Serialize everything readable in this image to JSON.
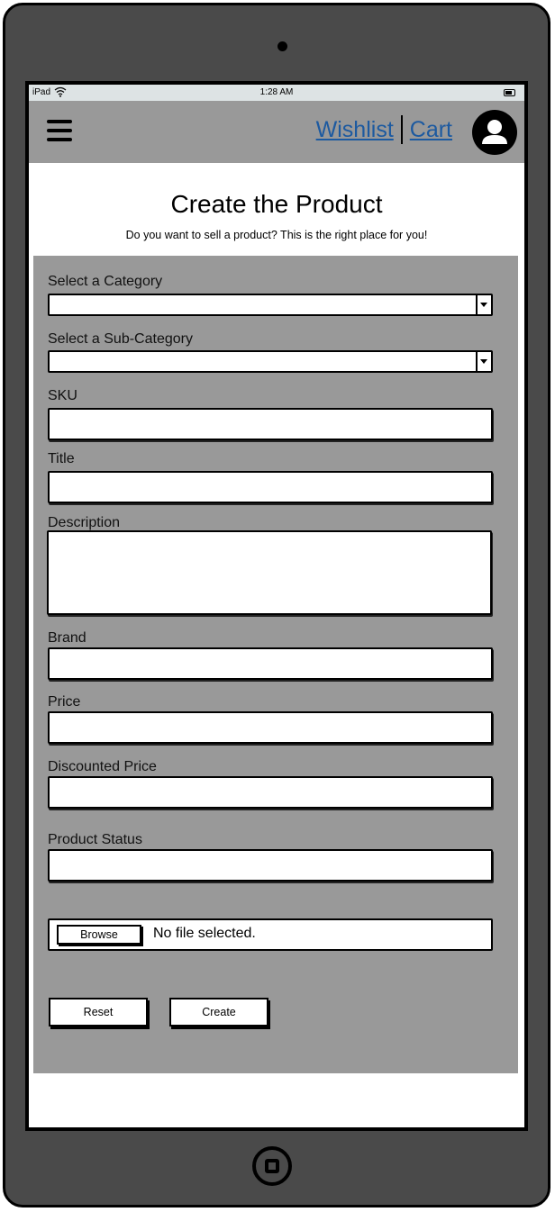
{
  "statusbar": {
    "device": "iPad",
    "time": "1:28 AM"
  },
  "nav": {
    "wishlist": "Wishlist",
    "cart": "Cart"
  },
  "page": {
    "title": "Create the Product",
    "subtitle": "Do you want to sell a product? This is the right place for you!"
  },
  "form": {
    "category_label": "Select a Category",
    "subcategory_label": "Select a Sub-Category",
    "sku_label": "SKU",
    "title_label": "Title",
    "description_label": "Description",
    "brand_label": "Brand",
    "price_label": "Price",
    "discounted_price_label": "Discounted Price",
    "product_status_label": "Product Status",
    "browse_label": "Browse",
    "file_status": "No file selected.",
    "reset_label": "Reset",
    "create_label": "Create"
  }
}
